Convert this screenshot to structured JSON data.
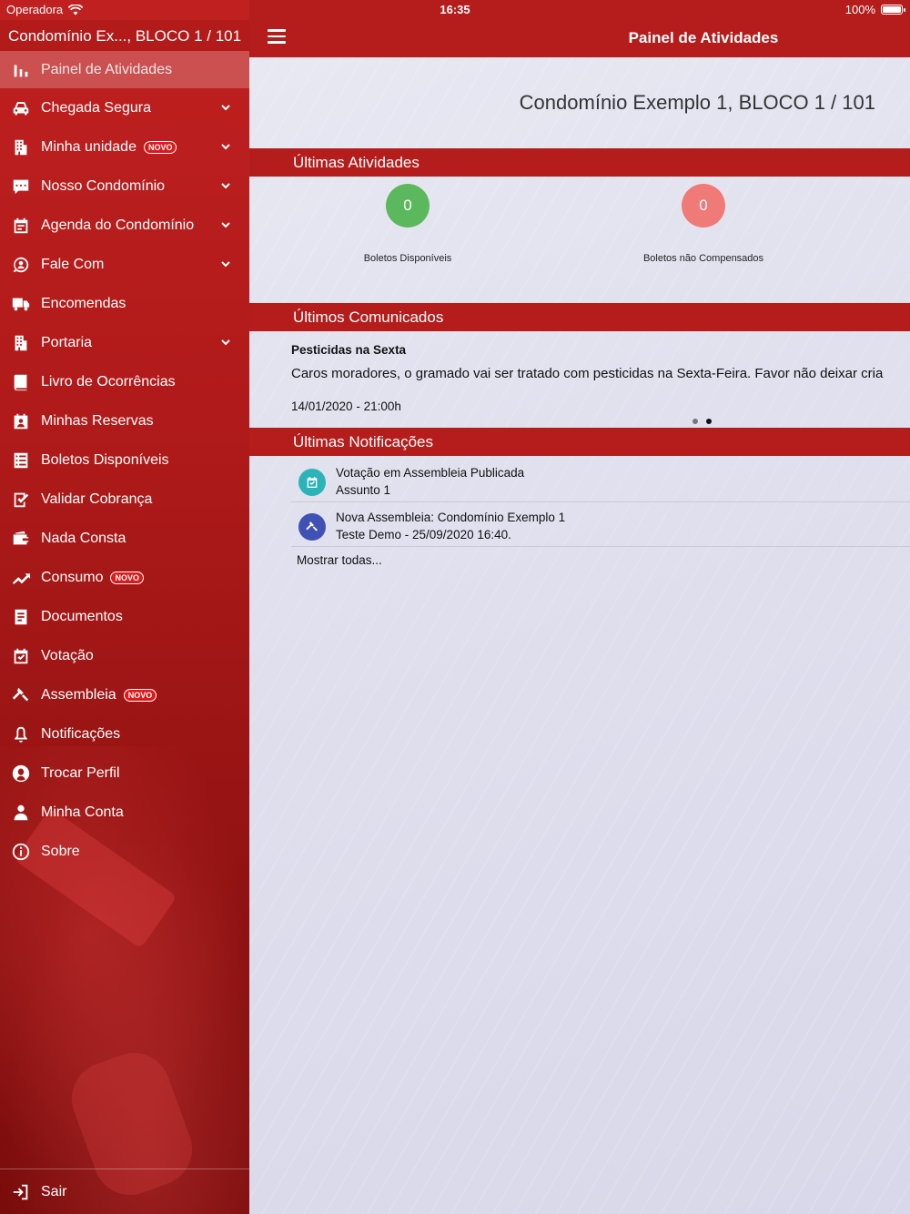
{
  "status_bar": {
    "carrier": "Operadora",
    "time": "16:35",
    "battery": "100%"
  },
  "sidebar": {
    "title": "Condomínio Ex..., BLOCO 1 / 101",
    "items": [
      {
        "label": "Painel de Atividades",
        "icon": "bar-chart-icon",
        "active": true
      },
      {
        "label": "Chegada Segura",
        "icon": "car-icon",
        "expandable": true
      },
      {
        "label": "Minha unidade",
        "icon": "building-icon",
        "expandable": true,
        "badge": "NOVO"
      },
      {
        "label": "Nosso Condomínio",
        "icon": "chat-icon",
        "expandable": true
      },
      {
        "label": "Agenda do Condomínio",
        "icon": "calendar-icon",
        "expandable": true
      },
      {
        "label": "Fale Com",
        "icon": "contact-icon",
        "expandable": true
      },
      {
        "label": "Encomendas",
        "icon": "truck-icon"
      },
      {
        "label": "Portaria",
        "icon": "building-icon",
        "expandable": true
      },
      {
        "label": "Livro de Ocorrências",
        "icon": "book-icon"
      },
      {
        "label": "Minhas Reservas",
        "icon": "calendar-person-icon"
      },
      {
        "label": "Boletos Disponíveis",
        "icon": "list-icon"
      },
      {
        "label": "Validar Cobrança",
        "icon": "check-list-icon"
      },
      {
        "label": "Nada Consta",
        "icon": "wallet-icon"
      },
      {
        "label": "Consumo",
        "icon": "trend-icon",
        "badge": "NOVO"
      },
      {
        "label": "Documentos",
        "icon": "document-icon"
      },
      {
        "label": "Votação",
        "icon": "calendar-check-icon"
      },
      {
        "label": "Assembleia",
        "icon": "gavel-icon",
        "badge": "NOVO"
      },
      {
        "label": "Notificações",
        "icon": "bell-icon"
      },
      {
        "label": "Trocar Perfil",
        "icon": "profile-icon"
      },
      {
        "label": "Minha Conta",
        "icon": "person-icon"
      },
      {
        "label": "Sobre",
        "icon": "info-icon"
      }
    ],
    "logout_label": "Sair"
  },
  "header": {
    "title": "Painel de Atividades"
  },
  "condo_name": "Condomínio Exemplo 1, BLOCO 1 / 101",
  "sections": {
    "activities": "Últimas Atividades",
    "communications": "Últimos Comunicados",
    "notifications": "Últimas Notificações"
  },
  "activities": [
    {
      "value": "0",
      "label": "Boletos Disponíveis",
      "color": "#5cb85c"
    },
    {
      "value": "0",
      "label": "Boletos não Compensados",
      "color": "#f07a78"
    }
  ],
  "communication": {
    "title": "Pesticidas na Sexta",
    "body": "Caros moradores, o gramado vai ser tratado com pesticidas na Sexta-Feira. Favor não deixar cria",
    "date": "14/01/2020 - 21:00h"
  },
  "notifications": [
    {
      "title": "Votação em Assembleia Publicada",
      "subtitle": "Assunto 1",
      "icon": "calendar-check-icon",
      "color": "#2bb3b8"
    },
    {
      "title": "Nova Assembleia: Condomínio Exemplo 1",
      "subtitle": "Teste Demo - 25/09/2020 16:40.",
      "icon": "gavel-icon",
      "color": "#3f51b5"
    }
  ],
  "show_all": "Mostrar todas...",
  "colors": {
    "brand": "#b51c1c"
  }
}
